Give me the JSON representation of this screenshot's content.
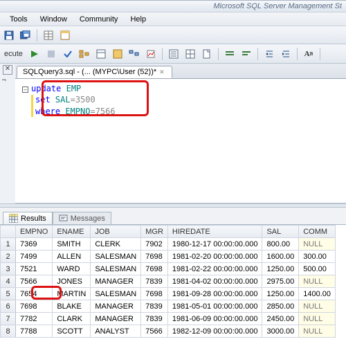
{
  "app_title_fragment": "Microsoft SQL Server Management St",
  "menu": {
    "tools": "Tools",
    "window": "Window",
    "community": "Community",
    "help": "Help"
  },
  "execute_label": "ecute",
  "doc_tab": "SQLQuery3.sql - (... (MYPC\\User (52))*",
  "sql": {
    "l1a": "update",
    "l1b": "EMP",
    "l2a": "set",
    "l2b": "SAL",
    "l2c": "=3500",
    "l3a": "where",
    "l3b": "EMPNO",
    "l3c": "=7566"
  },
  "results_tab": "Results",
  "messages_tab": "Messages",
  "columns": [
    "",
    "EMPNO",
    "ENAME",
    "JOB",
    "MGR",
    "HIREDATE",
    "SAL",
    "COMM"
  ],
  "rows": [
    {
      "n": "1",
      "empno": "7369",
      "ename": "SMITH",
      "job": "CLERK",
      "mgr": "7902",
      "hiredate": "1980-12-17 00:00:00.000",
      "sal": "800.00",
      "comm": "NULL"
    },
    {
      "n": "2",
      "empno": "7499",
      "ename": "ALLEN",
      "job": "SALESMAN",
      "mgr": "7698",
      "hiredate": "1981-02-20 00:00:00.000",
      "sal": "1600.00",
      "comm": "300.00"
    },
    {
      "n": "3",
      "empno": "7521",
      "ename": "WARD",
      "job": "SALESMAN",
      "mgr": "7698",
      "hiredate": "1981-02-22 00:00:00.000",
      "sal": "1250.00",
      "comm": "500.00"
    },
    {
      "n": "4",
      "empno": "7566",
      "ename": "JONES",
      "job": "MANAGER",
      "mgr": "7839",
      "hiredate": "1981-04-02 00:00:00.000",
      "sal": "2975.00",
      "comm": "NULL"
    },
    {
      "n": "5",
      "empno": "7654",
      "ename": "MARTIN",
      "job": "SALESMAN",
      "mgr": "7698",
      "hiredate": "1981-09-28 00:00:00.000",
      "sal": "1250.00",
      "comm": "1400.00"
    },
    {
      "n": "6",
      "empno": "7698",
      "ename": "BLAKE",
      "job": "MANAGER",
      "mgr": "7839",
      "hiredate": "1981-05-01 00:00:00.000",
      "sal": "2850.00",
      "comm": "NULL"
    },
    {
      "n": "7",
      "empno": "7782",
      "ename": "CLARK",
      "job": "MANAGER",
      "mgr": "7839",
      "hiredate": "1981-06-09 00:00:00.000",
      "sal": "2450.00",
      "comm": "NULL"
    },
    {
      "n": "8",
      "empno": "7788",
      "ename": "SCOTT",
      "job": "ANALYST",
      "mgr": "7566",
      "hiredate": "1982-12-09 00:00:00.000",
      "sal": "3000.00",
      "comm": "NULL"
    }
  ]
}
